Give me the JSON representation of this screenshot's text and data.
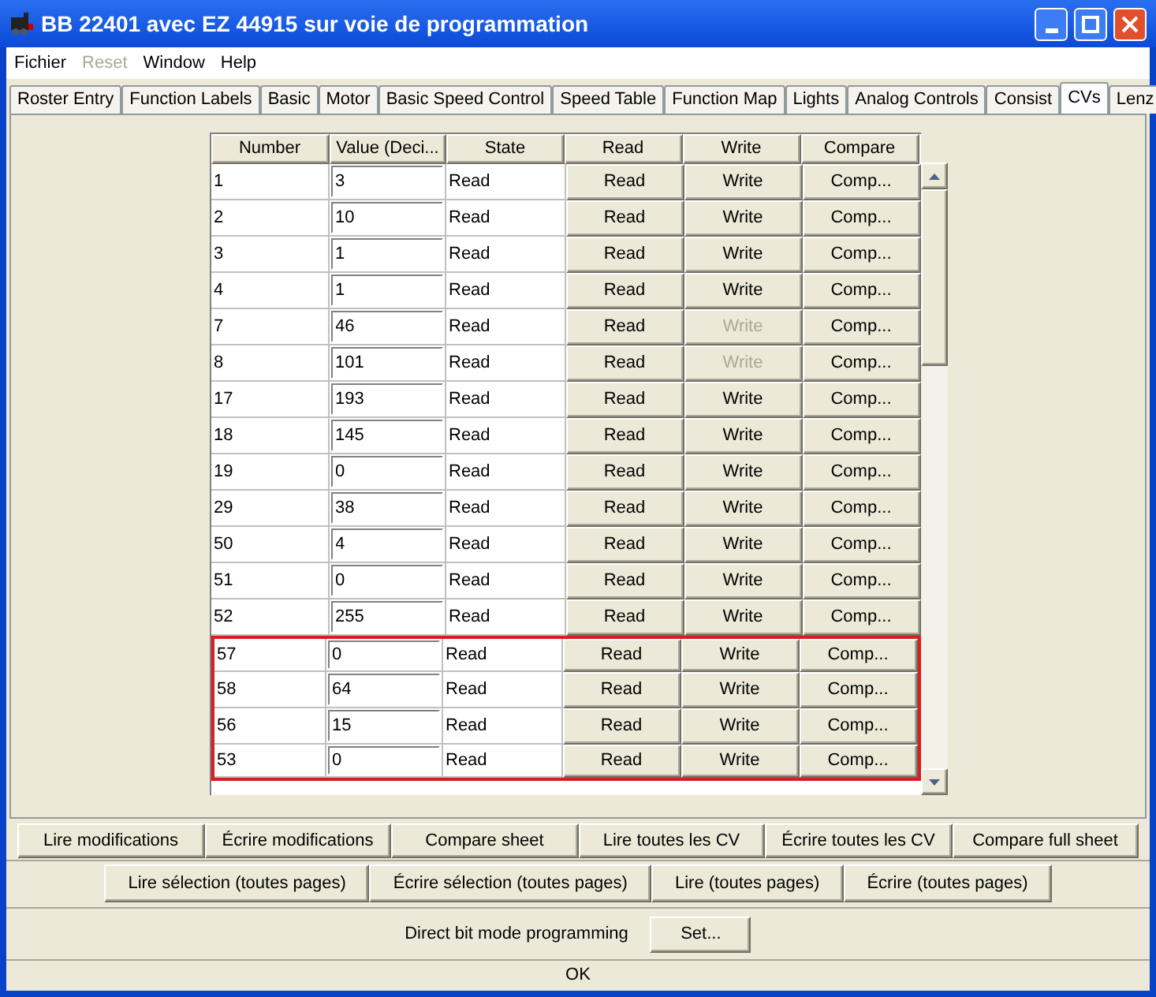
{
  "window": {
    "title": "BB 22401 avec EZ 44915 sur voie de programmation"
  },
  "menu": [
    {
      "label": "Fichier",
      "disabled": false
    },
    {
      "label": "Reset",
      "disabled": true
    },
    {
      "label": "Window",
      "disabled": false
    },
    {
      "label": "Help",
      "disabled": false
    }
  ],
  "tabs": [
    {
      "label": "Roster Entry",
      "selected": false
    },
    {
      "label": "Function Labels",
      "selected": false
    },
    {
      "label": "Basic",
      "selected": false
    },
    {
      "label": "Motor",
      "selected": false
    },
    {
      "label": "Basic Speed Control",
      "selected": false
    },
    {
      "label": "Speed Table",
      "selected": false
    },
    {
      "label": "Function Map",
      "selected": false
    },
    {
      "label": "Lights",
      "selected": false
    },
    {
      "label": "Analog Controls",
      "selected": false
    },
    {
      "label": "Consist",
      "selected": false
    },
    {
      "label": "CVs",
      "selected": true
    },
    {
      "label": "Lenz",
      "selected": false
    }
  ],
  "table": {
    "columns": [
      "Number",
      "Value (Deci...",
      "State",
      "Read",
      "Write",
      "Compare"
    ],
    "rows": [
      {
        "number": "1",
        "value": "3",
        "state": "Read",
        "read": "Read",
        "write": "Write",
        "compare": "Comp...",
        "write_disabled": false,
        "highlighted": false
      },
      {
        "number": "2",
        "value": "10",
        "state": "Read",
        "read": "Read",
        "write": "Write",
        "compare": "Comp...",
        "write_disabled": false,
        "highlighted": false
      },
      {
        "number": "3",
        "value": "1",
        "state": "Read",
        "read": "Read",
        "write": "Write",
        "compare": "Comp...",
        "write_disabled": false,
        "highlighted": false
      },
      {
        "number": "4",
        "value": "1",
        "state": "Read",
        "read": "Read",
        "write": "Write",
        "compare": "Comp...",
        "write_disabled": false,
        "highlighted": false
      },
      {
        "number": "7",
        "value": "46",
        "state": "Read",
        "read": "Read",
        "write": "Write",
        "compare": "Comp...",
        "write_disabled": true,
        "highlighted": false
      },
      {
        "number": "8",
        "value": "101",
        "state": "Read",
        "read": "Read",
        "write": "Write",
        "compare": "Comp...",
        "write_disabled": true,
        "highlighted": false
      },
      {
        "number": "17",
        "value": "193",
        "state": "Read",
        "read": "Read",
        "write": "Write",
        "compare": "Comp...",
        "write_disabled": false,
        "highlighted": false
      },
      {
        "number": "18",
        "value": "145",
        "state": "Read",
        "read": "Read",
        "write": "Write",
        "compare": "Comp...",
        "write_disabled": false,
        "highlighted": false
      },
      {
        "number": "19",
        "value": "0",
        "state": "Read",
        "read": "Read",
        "write": "Write",
        "compare": "Comp...",
        "write_disabled": false,
        "highlighted": false
      },
      {
        "number": "29",
        "value": "38",
        "state": "Read",
        "read": "Read",
        "write": "Write",
        "compare": "Comp...",
        "write_disabled": false,
        "highlighted": false
      },
      {
        "number": "50",
        "value": "4",
        "state": "Read",
        "read": "Read",
        "write": "Write",
        "compare": "Comp...",
        "write_disabled": false,
        "highlighted": false
      },
      {
        "number": "51",
        "value": "0",
        "state": "Read",
        "read": "Read",
        "write": "Write",
        "compare": "Comp...",
        "write_disabled": false,
        "highlighted": false
      },
      {
        "number": "52",
        "value": "255",
        "state": "Read",
        "read": "Read",
        "write": "Write",
        "compare": "Comp...",
        "write_disabled": false,
        "highlighted": false
      },
      {
        "number": "57",
        "value": "0",
        "state": "Read",
        "read": "Read",
        "write": "Write",
        "compare": "Comp...",
        "write_disabled": false,
        "highlighted": true
      },
      {
        "number": "58",
        "value": "64",
        "state": "Read",
        "read": "Read",
        "write": "Write",
        "compare": "Comp...",
        "write_disabled": false,
        "highlighted": true
      },
      {
        "number": "56",
        "value": "15",
        "state": "Read",
        "read": "Read",
        "write": "Write",
        "compare": "Comp...",
        "write_disabled": false,
        "highlighted": true
      },
      {
        "number": "53",
        "value": "0",
        "state": "Read",
        "read": "Read",
        "write": "Write",
        "compare": "Comp...",
        "write_disabled": false,
        "highlighted": true
      }
    ]
  },
  "buttons_row_1": [
    "Lire modifications",
    "Écrire modifications",
    "Compare sheet",
    "Lire toutes les CV",
    "Écrire toutes les CV",
    "Compare full sheet"
  ],
  "buttons_row_2": [
    "Lire sélection (toutes pages)",
    "Écrire sélection (toutes pages)",
    "Lire (toutes pages)",
    "Écrire (toutes pages)"
  ],
  "direct_bit": {
    "label": "Direct bit mode programming",
    "button": "Set..."
  },
  "status_bar": "OK"
}
